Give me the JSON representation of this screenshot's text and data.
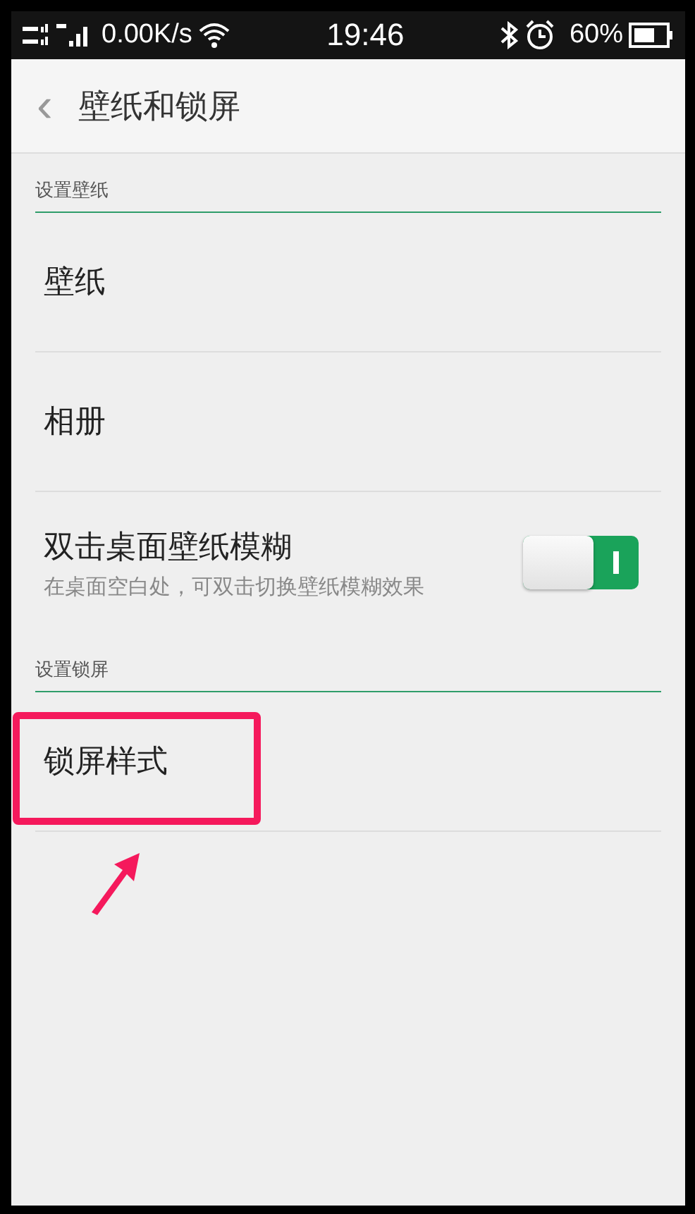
{
  "status_bar": {
    "network_speed": "0.00K/s",
    "time": "19:46",
    "battery": "60%"
  },
  "header": {
    "back": "‹",
    "title": "壁纸和锁屏"
  },
  "sections": [
    {
      "title": "设置壁纸",
      "items": [
        {
          "kind": "link",
          "label": "壁纸",
          "highlighted": false
        },
        {
          "kind": "link",
          "label": "相册",
          "highlighted": false
        },
        {
          "kind": "toggle",
          "label": "双击桌面壁纸模糊",
          "subtitle": "在桌面空白处，可双击切换壁纸模糊效果",
          "on": true
        }
      ]
    },
    {
      "title": "设置锁屏",
      "items": [
        {
          "kind": "link",
          "label": "锁屏样式",
          "highlighted": true
        }
      ]
    }
  ]
}
